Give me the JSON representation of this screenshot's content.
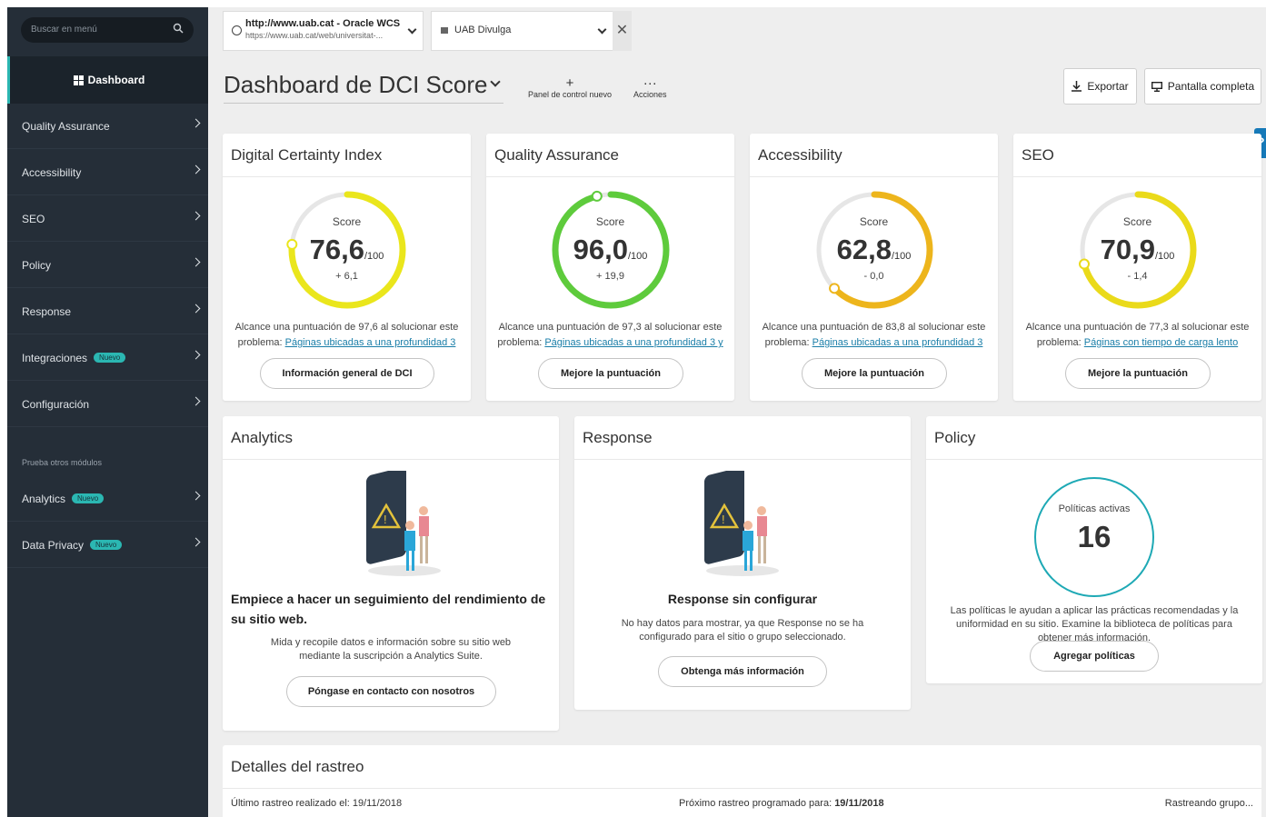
{
  "sidebar": {
    "search_placeholder": "Buscar en menú",
    "dashboard_label": "Dashboard",
    "items": [
      {
        "label": "Quality Assurance"
      },
      {
        "label": "Accessibility"
      },
      {
        "label": "SEO"
      },
      {
        "label": "Policy"
      },
      {
        "label": "Response"
      },
      {
        "label": "Integraciones",
        "badge": "Nuevo"
      },
      {
        "label": "Configuración"
      }
    ],
    "section_label": "Prueba otros módulos",
    "other_modules": [
      {
        "label": "Analytics",
        "badge": "Nuevo"
      },
      {
        "label": "Data Privacy",
        "badge": "Nuevo"
      }
    ]
  },
  "topbar": {
    "site_name": "http://www.uab.cat - Oracle WCS",
    "site_url": "https://www.uab.cat/web/universitat-...",
    "group_name": "UAB Divulga",
    "close_symbol": "✕"
  },
  "header": {
    "title": "Dashboard de DCI Score",
    "new_panel_symbol": "+",
    "new_panel_label": "Panel de control nuevo",
    "actions_symbol": "···",
    "actions_label": "Acciones",
    "export_label": "Exportar",
    "fullscreen_label": "Pantalla completa",
    "help_symbol": "?"
  },
  "score_cards": [
    {
      "title": "Digital Certainty Index",
      "score_label": "Score",
      "value": "76,6",
      "denominator": "/100",
      "score_fraction": 0.766,
      "delta": "+ 6,1",
      "desc_prefix": "Alcance una puntuación de 97,6 al solucionar este problema: ",
      "desc_link": "Páginas ubicadas a una profundidad 3",
      "button": "Información general de DCI",
      "color": "#eae61c"
    },
    {
      "title": "Quality Assurance",
      "score_label": "Score",
      "value": "96,0",
      "denominator": "/100",
      "score_fraction": 0.96,
      "delta": "+ 19,9",
      "desc_prefix": "Alcance una puntuación de 97,3 al solucionar este problema: ",
      "desc_link": "Páginas ubicadas a una profundidad 3 y",
      "button": "Mejore la puntuación",
      "color": "#5ecb3c"
    },
    {
      "title": "Accessibility",
      "score_label": "Score",
      "value": "62,8",
      "denominator": "/100",
      "score_fraction": 0.628,
      "delta": "- 0,0",
      "desc_prefix": "Alcance una puntuación de 83,8 al solucionar este problema: ",
      "desc_link": "Páginas ubicadas a una profundidad 3",
      "button": "Mejore la puntuación",
      "color": "#edb51c"
    },
    {
      "title": "SEO",
      "score_label": "Score",
      "value": "70,9",
      "denominator": "/100",
      "score_fraction": 0.709,
      "delta": "- 1,4",
      "desc_prefix": "Alcance una puntuación de 77,3 al solucionar este problema: ",
      "desc_link": "Páginas con tiempo de carga lento",
      "button": "Mejore la puntuación",
      "color": "#eada1a"
    }
  ],
  "analytics": {
    "title": "Analytics",
    "heading": "Empiece a hacer un seguimiento del rendimiento de su sitio web.",
    "text": "Mida y recopile datos e información sobre su sitio web mediante la suscripción a Analytics Suite.",
    "button": "Póngase en contacto con nosotros"
  },
  "response": {
    "title": "Response",
    "heading": "Response sin configurar",
    "text": "No hay datos para mostrar, ya que Response no se ha configurado para el sitio o grupo seleccionado.",
    "button": "Obtenga más información"
  },
  "policy": {
    "title": "Policy",
    "circle_label": "Políticas activas",
    "count": "16",
    "text": "Las políticas le ayudan a aplicar las prácticas recomendadas y la uniformidad en su sitio. Examine la biblioteca de políticas para obtener más información.",
    "button": "Agregar políticas"
  },
  "crawl": {
    "title": "Detalles del rastreo",
    "last_label": "Último rastreo realizado el: 19/11/2018",
    "next_label": "Próximo rastreo programado para: ",
    "next_date": "19/11/2018",
    "status": "Rastreando grupo..."
  }
}
